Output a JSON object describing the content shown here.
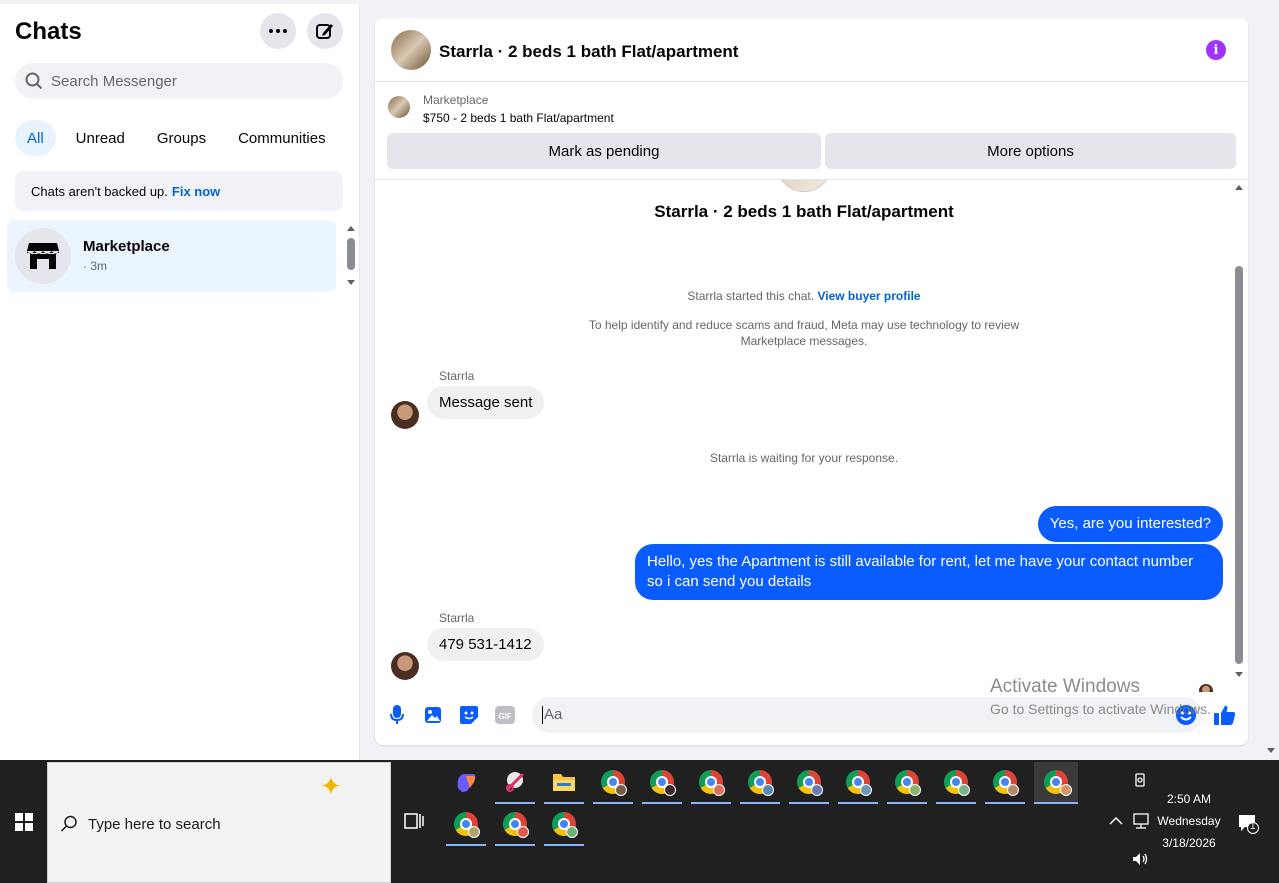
{
  "sidebar": {
    "title": "Chats",
    "search_placeholder": "Search Messenger",
    "filters": [
      "All",
      "Unread",
      "Groups",
      "Communities"
    ],
    "backup_text": "Chats aren't backed up.",
    "backup_link": "Fix now",
    "chat": {
      "name": "Marketplace",
      "meta": "· 3m"
    }
  },
  "header": {
    "title": "Starrla · 2 beds 1 bath Flat/apartment",
    "marketplace_label": "Marketplace",
    "listing": "$750 - 2 beds 1 bath Flat/apartment",
    "mark_pending": "Mark as pending",
    "more_options": "More options"
  },
  "conversation": {
    "title": "Starrla · 2 beds 1 bath Flat/apartment",
    "started_text": "Starrla started this chat.",
    "started_link": "View buyer profile",
    "safety_line1": "To help identify and reduce scams and fraud, Meta may use technology to review",
    "safety_line2": "Marketplace messages.",
    "sender1": "Starrla",
    "msg1": "Message sent",
    "waiting": "Starrla is waiting for your response.",
    "out1": "Yes, are you interested?",
    "out2_line1": "Hello, yes the Apartment is still available for rent, let me have your contact number",
    "out2_line2": "so i can send you details",
    "sender2": "Starrla",
    "msg2": "479 531-1412"
  },
  "composer": {
    "placeholder": "Aa"
  },
  "watermark": {
    "line1": "Activate Windows",
    "line2": "Go to Settings to activate Windows."
  },
  "taskbar": {
    "search_placeholder": "Type here to search",
    "time": "2:50 AM",
    "day": "Wednesday",
    "date": "3/18/2026",
    "notifications": "1"
  },
  "colors": {
    "accent": "#0a5cff",
    "link": "#0064d1",
    "info": "#a033ff",
    "taskbar": "#202020"
  }
}
